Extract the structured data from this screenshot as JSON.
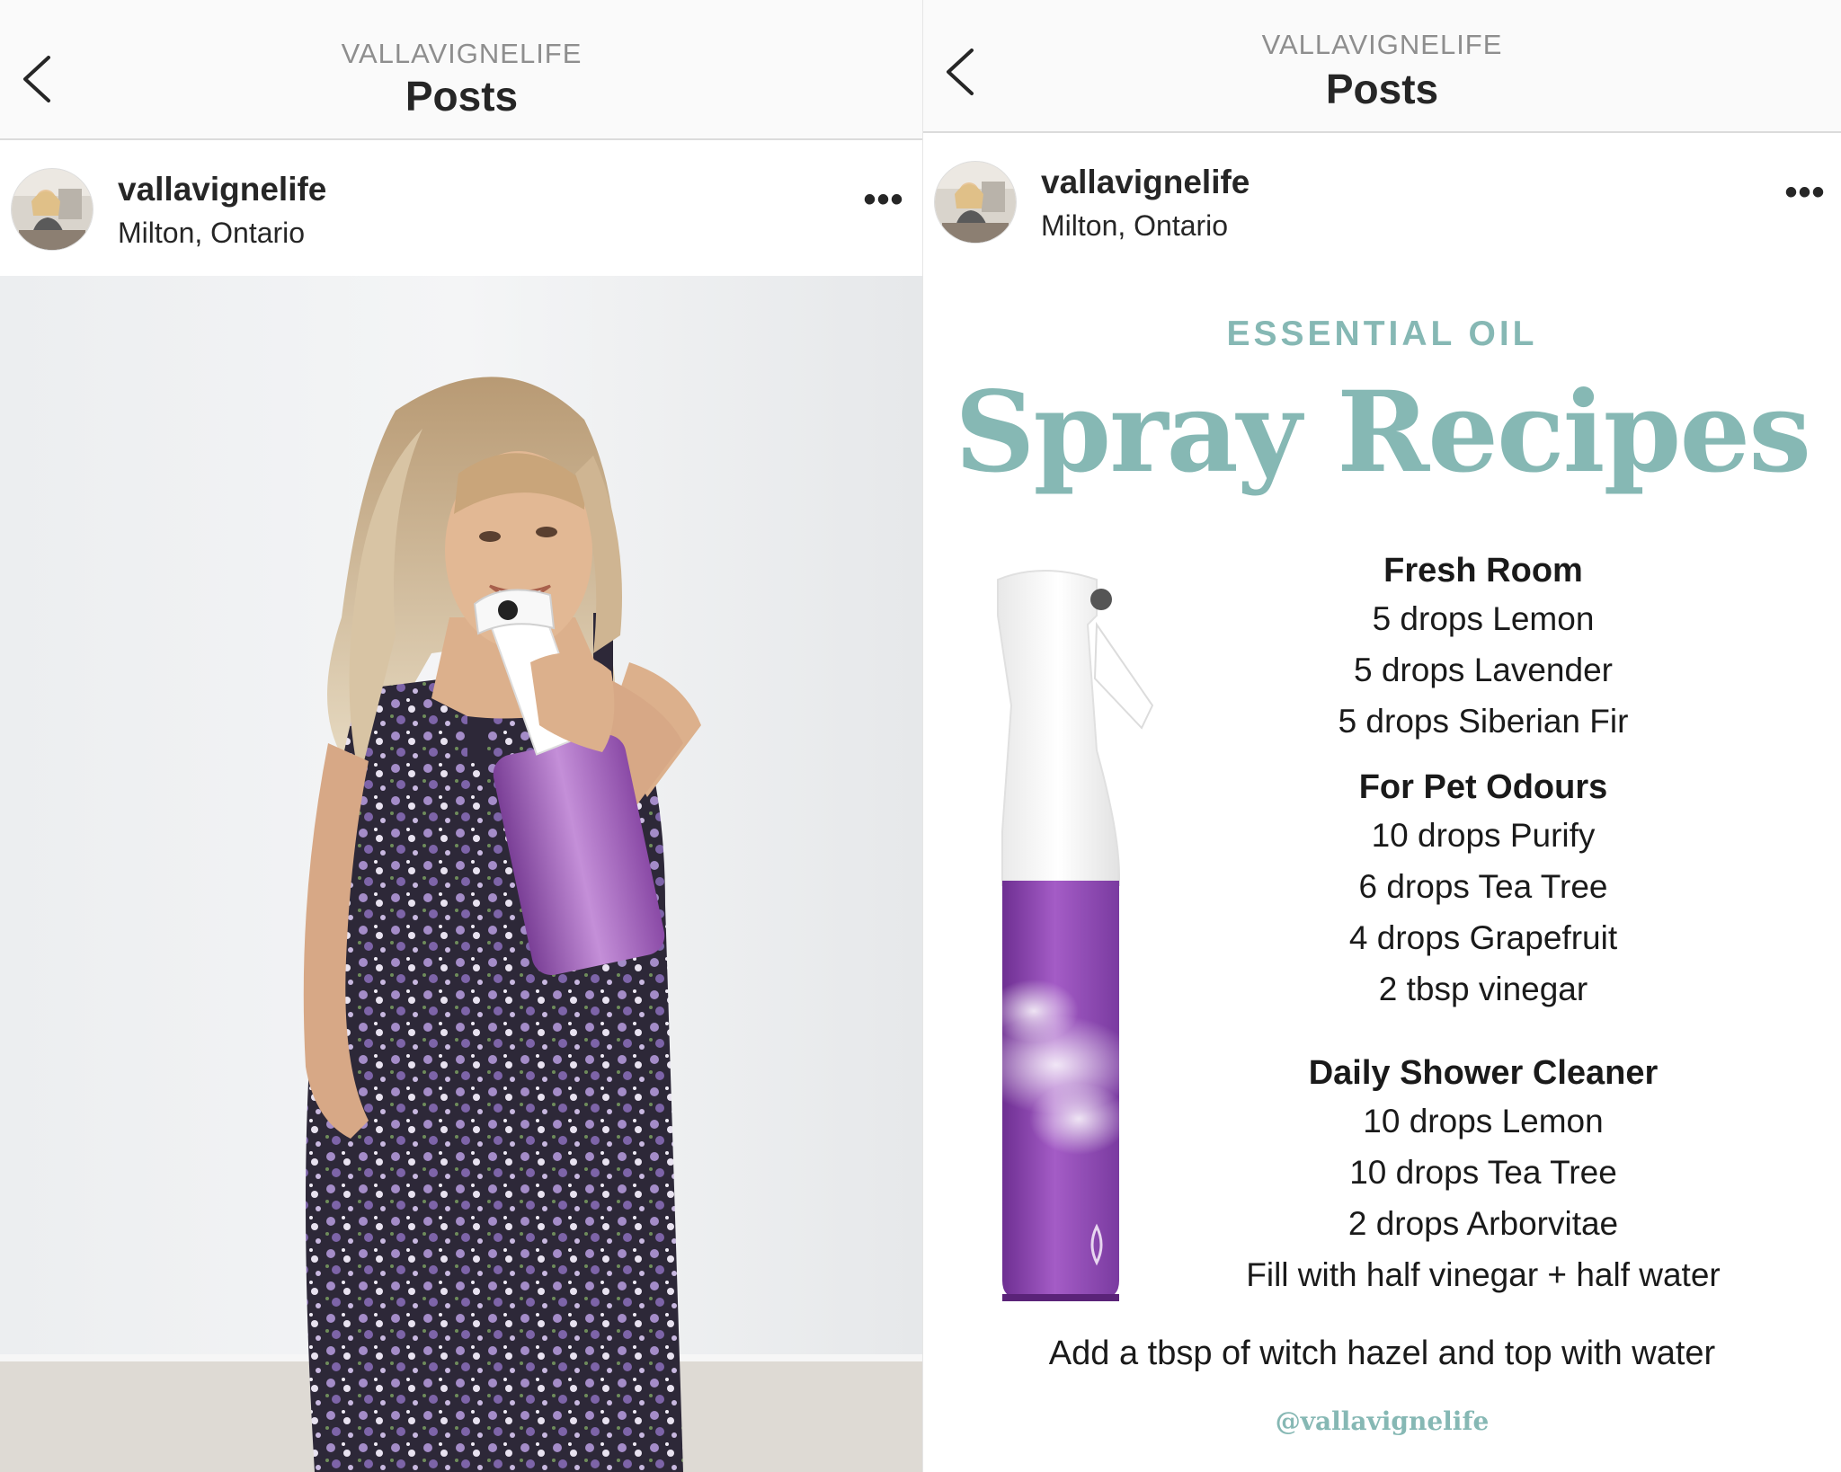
{
  "left_screen": {
    "nav": {
      "account": "VALLAVIGNELIFE",
      "title": "Posts",
      "back_icon": "chevron-left-icon"
    },
    "post": {
      "username": "vallavignelife",
      "location": "Milton, Ontario",
      "more_label": "•••",
      "photo_description": "woman in purple floral jumpsuit holding purple spray bottle"
    }
  },
  "right_screen": {
    "nav": {
      "account": "VALLAVIGNELIFE",
      "title": "Posts",
      "back_icon": "chevron-left-icon"
    },
    "post": {
      "username": "vallavignelife",
      "location": "Milton, Ontario",
      "more_label": "•••"
    },
    "recipe_card": {
      "kicker": "ESSENTIAL OIL",
      "title": "Spray Recipes",
      "accent_color": "#86b8b4",
      "recipes": [
        {
          "title": "Fresh Room",
          "lines": [
            "5 drops Lemon",
            "5 drops Lavender",
            "5 drops Siberian Fir"
          ]
        },
        {
          "title": "For Pet Odours",
          "lines": [
            "10 drops Purify",
            "6 drops Tea Tree",
            "4 drops Grapefruit",
            "2 tbsp vinegar"
          ]
        },
        {
          "title": "Daily Shower Cleaner",
          "lines": [
            "10 drops Lemon",
            "10 drops Tea Tree",
            "2 drops Arborvitae",
            "Fill with half vinegar + half water"
          ]
        }
      ],
      "footer": "Add a tbsp of witch hazel and top with water",
      "handle": "@vallavignelife"
    }
  }
}
